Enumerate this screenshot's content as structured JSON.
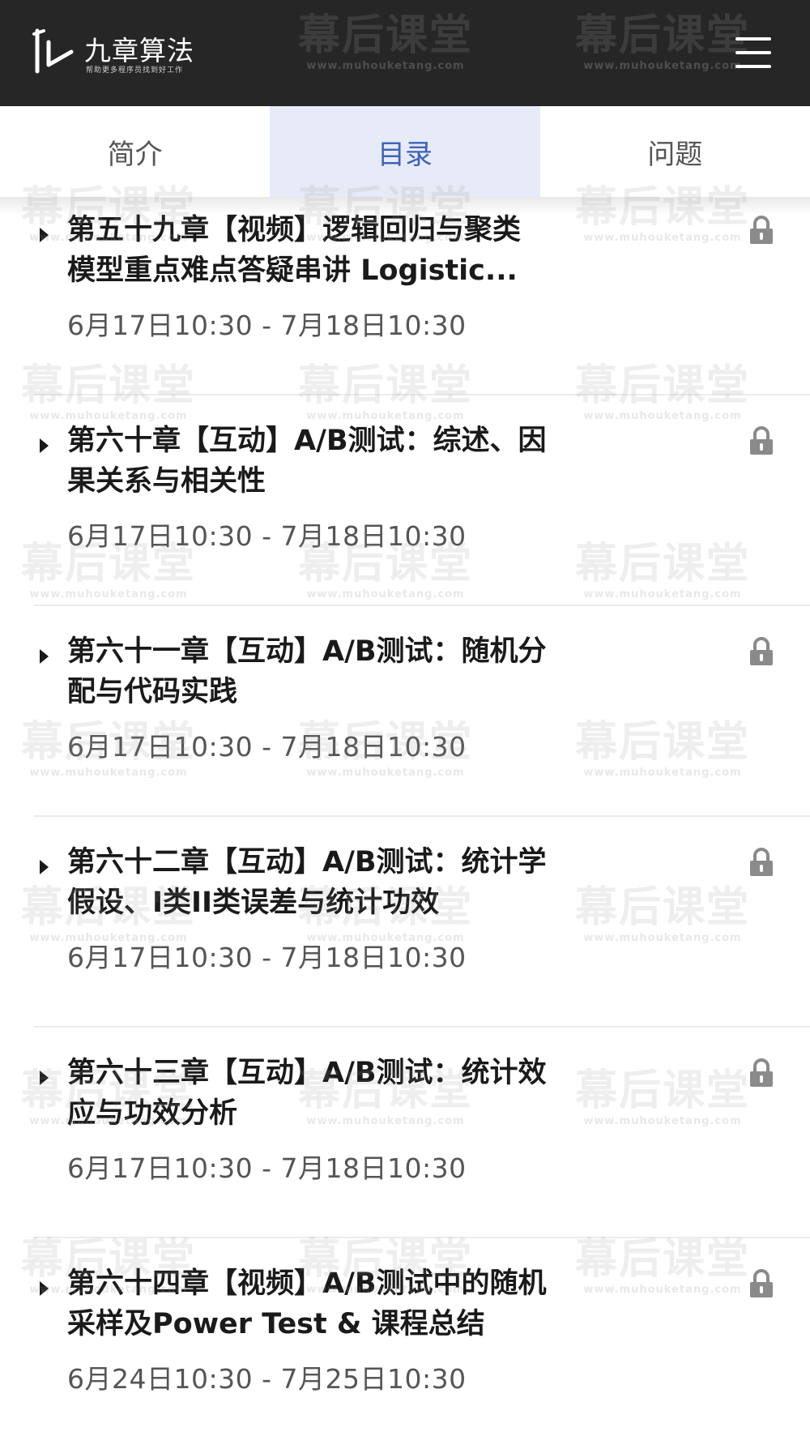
{
  "header": {
    "brand_name": "九章算法",
    "brand_slogan": "帮助更多程序员找到好工作"
  },
  "tabs": [
    {
      "label": "简介",
      "active": false
    },
    {
      "label": "目录",
      "active": true
    },
    {
      "label": "问题",
      "active": false
    }
  ],
  "chapters": [
    {
      "title": "第五十九章【视频】逻辑回归与聚类\n模型重点难点答疑串讲 Logistic...",
      "time": "6月17日10:30 - 7月18日10:30",
      "locked": true
    },
    {
      "title": "第六十章【互动】A/B测试：综述、因\n果关系与相关性",
      "time": "6月17日10:30 - 7月18日10:30",
      "locked": true
    },
    {
      "title": "第六十一章【互动】A/B测试：随机分\n配与代码实践",
      "time": "6月17日10:30 - 7月18日10:30",
      "locked": true
    },
    {
      "title": "第六十二章【互动】A/B测试：统计学\n假设、I类II类误差与统计功效",
      "time": "6月17日10:30 - 7月18日10:30",
      "locked": true
    },
    {
      "title": "第六十三章【互动】A/B测试：统计效\n应与功效分析",
      "time": "6月17日10:30 - 7月18日10:30",
      "locked": true
    },
    {
      "title": "第六十四章【视频】A/B测试中的随机\n采样及Power Test & 课程总结",
      "time": "6月24日10:30 - 7月25日10:30",
      "locked": true
    }
  ],
  "watermark": {
    "text": "幕后课堂",
    "url": "www.muhouketang.com"
  },
  "colors": {
    "header_bg": "#262626",
    "tab_active_bg": "#e7ebf8",
    "tab_active_text": "#3e63b8",
    "lock_icon": "#8a8a8a"
  }
}
